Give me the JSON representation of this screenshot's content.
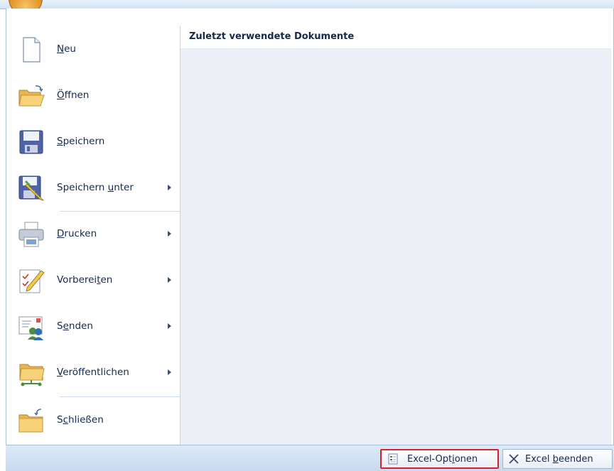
{
  "recent": {
    "title": "Zuletzt verwendete Dokumente"
  },
  "menu": {
    "items": [
      {
        "pre": "",
        "u": "N",
        "post": "eu",
        "icon": "new-document-icon",
        "submenu": false
      },
      {
        "pre": "",
        "u": "Ö",
        "post": "ffnen",
        "icon": "open-folder-icon",
        "submenu": false
      },
      {
        "pre": "",
        "u": "S",
        "post": "peichern",
        "icon": "save-disk-icon",
        "submenu": false
      },
      {
        "pre": "Speichern ",
        "u": "u",
        "post": "nter",
        "icon": "save-as-icon",
        "submenu": true
      },
      {
        "pre": "",
        "u": "D",
        "post": "rucken",
        "icon": "printer-icon",
        "submenu": true
      },
      {
        "pre": "Vorberei",
        "u": "t",
        "post": "en",
        "icon": "prepare-pencil-icon",
        "submenu": true
      },
      {
        "pre": "S",
        "u": "e",
        "post": "nden",
        "icon": "send-users-icon",
        "submenu": true
      },
      {
        "pre": "",
        "u": "V",
        "post": "eröffentlichen",
        "icon": "publish-folder-icon",
        "submenu": true
      },
      {
        "pre": "S",
        "u": "c",
        "post": "hließen",
        "icon": "close-folder-icon",
        "submenu": false
      }
    ]
  },
  "footer": {
    "options": {
      "pre": "Excel-Opt",
      "u": "i",
      "post": "onen"
    },
    "exit": {
      "pre": "Excel ",
      "u": "b",
      "post": "eenden"
    }
  },
  "colors": {
    "accent_border": "#d9212a",
    "menu_bg": "#eceff5",
    "frame_blue": "#a8bfdc"
  }
}
